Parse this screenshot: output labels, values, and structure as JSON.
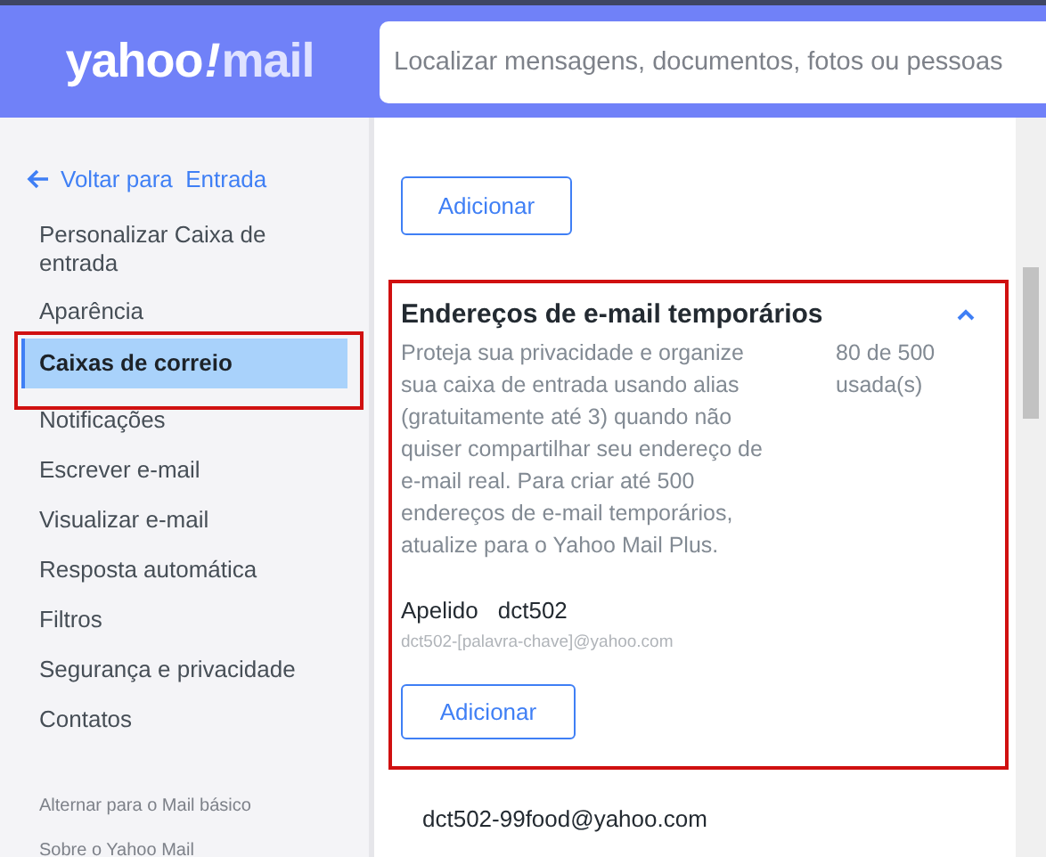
{
  "header": {
    "logo": {
      "brand": "yahoo",
      "mark": "!",
      "product": "mail"
    },
    "search": {
      "placeholder": "Localizar mensagens, documentos, fotos ou pessoas"
    }
  },
  "sidebar": {
    "back_link": {
      "prefix": "Voltar para",
      "target": "Entrada"
    },
    "items": [
      {
        "label": "Personalizar Caixa de entrada",
        "selected": false
      },
      {
        "label": "Aparência",
        "selected": false
      },
      {
        "label": "Caixas de correio",
        "selected": true
      },
      {
        "label": "Notificações",
        "selected": false
      },
      {
        "label": "Escrever e-mail",
        "selected": false
      },
      {
        "label": "Visualizar e-mail",
        "selected": false
      },
      {
        "label": "Resposta automática",
        "selected": false
      },
      {
        "label": "Filtros",
        "selected": false
      },
      {
        "label": "Segurança e privacidade",
        "selected": false
      },
      {
        "label": "Contatos",
        "selected": false
      }
    ],
    "footer_links": [
      "Alternar para o Mail básico",
      "Sobre o Yahoo Mail"
    ]
  },
  "content": {
    "top_button": "Adicionar",
    "temp_addresses": {
      "title": "Endereços de e-mail temporários",
      "expanded": true,
      "description": "Proteja sua privacidade e organize sua caixa de entrada usando alias (gratuitamente até 3) quando não quiser compartilhar seu endereço de e-mail real. Para criar até 500 endereços de e-mail temporários, atualize para o Yahoo Mail Plus.",
      "usage": "80 de 500 usada(s)",
      "nickname_label": "Apelido",
      "nickname": "dct502",
      "pattern": "dct502-[palavra-chave]@yahoo.com",
      "button": "Adicionar"
    },
    "addresses": [
      "dct502-99food@yahoo.com"
    ]
  }
}
